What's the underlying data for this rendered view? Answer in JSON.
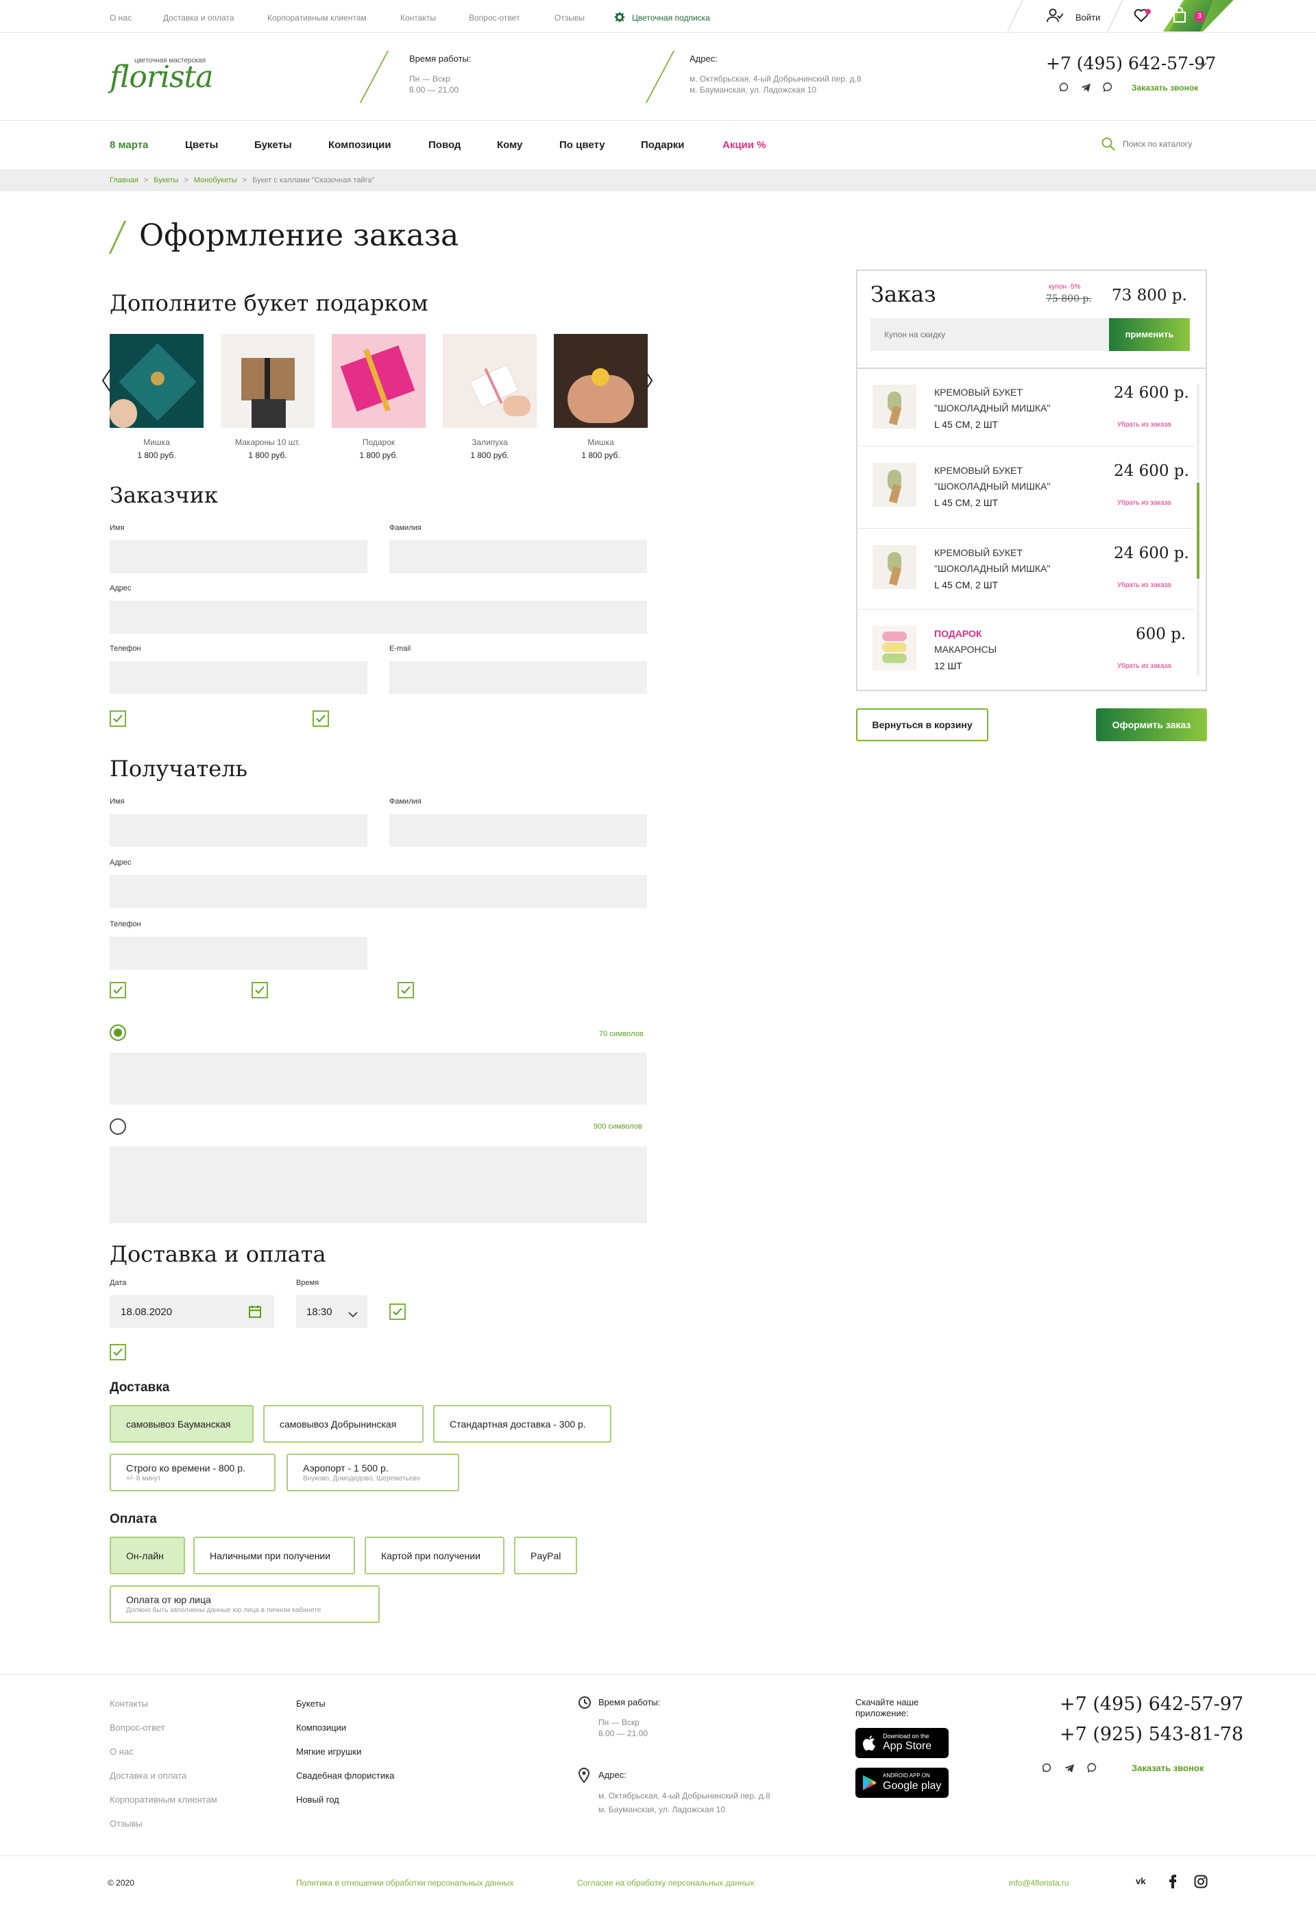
{
  "topbar": {
    "links": [
      "О нас",
      "Доставка и оплата",
      "Корпоративным клиентам",
      "Контакты",
      "Вопрос-ответ",
      "Отзывы"
    ],
    "subscription": "Цветочная подписка",
    "login": "Войти",
    "cart_count": "3"
  },
  "header": {
    "logo_tagline": "цветочная мастерская",
    "logo_text": "florista",
    "hours_label": "Время работы:",
    "hours_days": "Пн — Вскр",
    "hours_time": "8.00 — 21.00",
    "address_label": "Адрес:",
    "address_1": "м. Октябрьская, 4-ый Добрынинский пер. д.8",
    "address_2": "м. Бауманская, ул. Ладожская 10",
    "phone": "+7 (495) 642-57-97",
    "callback": "Заказать звонок"
  },
  "nav": {
    "items": [
      "8 марта",
      "Цветы",
      "Букеты",
      "Композиции",
      "Повод",
      "Кому",
      "По цвету",
      "Подарки",
      "Акции %"
    ],
    "search_placeholder": "Поиск по каталогу"
  },
  "breadcrumb": [
    "Главная",
    ">",
    "Букеты",
    ">",
    "Монобукеты",
    ">",
    "Букет с каллами \"Сказочная тайга\""
  ],
  "page_title": "Оформление заказа",
  "gifts": {
    "title": "Дополните букет подарком",
    "items": [
      {
        "name": "Мишка",
        "price": "1 800 руб."
      },
      {
        "name": "Макароны 10 шт.",
        "price": "1 800 руб."
      },
      {
        "name": "Подарок",
        "price": "1 800 руб."
      },
      {
        "name": "Залипуха",
        "price": "1 800 руб."
      },
      {
        "name": "Мишка",
        "price": "1 800 руб."
      }
    ]
  },
  "customer": {
    "title": "Заказчик",
    "first_name": "Имя",
    "last_name": "Фамилия",
    "address": "Адрес",
    "phone": "Телефон",
    "email": "E-mail"
  },
  "recipient": {
    "title": "Получатель",
    "first_name": "Имя",
    "last_name": "Фамилия",
    "address": "Адрес",
    "phone": "Телефон",
    "counter_1": "70 символов",
    "counter_2": "900 символов"
  },
  "delivery": {
    "title": "Доставка и оплата",
    "date_label": "Дата",
    "date_value": "18.08.2020",
    "time_label": "Время",
    "time_value": "18:30",
    "delivery_title": "Доставка",
    "options": [
      {
        "label": "самовывоз Бауманская",
        "sub": ""
      },
      {
        "label": "самовывоз Добрынинская",
        "sub": ""
      },
      {
        "label": "Стандартная доставка - 300 р.",
        "sub": ""
      },
      {
        "label": "Строго ко времени - 800 р.",
        "sub": "+/- 8 минут"
      },
      {
        "label": "Аэропорт - 1 500 р.",
        "sub": "Внуково, Домодедово, Шереметьево"
      }
    ],
    "payment_title": "Оплата",
    "payments": [
      {
        "label": "Он-лайн",
        "sub": ""
      },
      {
        "label": "Наличными при получении",
        "sub": ""
      },
      {
        "label": "Картой при получении",
        "sub": ""
      },
      {
        "label": "PayPal",
        "sub": ""
      },
      {
        "label": "Оплата от юр лица",
        "sub": "Должно быть заполнены данные юр лица в личном кабинете"
      }
    ]
  },
  "order": {
    "title": "Заказ",
    "coupon_note": "купон -5%",
    "old_total": "75 800 р.",
    "total": "73 800 р.",
    "coupon_placeholder": "Купон на скидку",
    "apply": "применить",
    "items": [
      {
        "title_1": "КРЕМОВЫЙ БУКЕТ",
        "title_2": "\"ШОКОЛАДНЫЙ МИШКА\"",
        "meta": "L 45 СМ, 2 ШТ",
        "price": "24 600 р.",
        "remove": "Убрать из заказа"
      },
      {
        "title_1": "КРЕМОВЫЙ БУКЕТ",
        "title_2": "\"ШОКОЛАДНЫЙ МИШКА\"",
        "meta": "L 45 СМ, 2 ШТ",
        "price": "24 600 р.",
        "remove": "Убрать из заказа"
      },
      {
        "title_1": "КРЕМОВЫЙ БУКЕТ",
        "title_2": "\"ШОКОЛАДНЫЙ МИШКА\"",
        "meta": "L 45 СМ, 2 ШТ",
        "price": "24 600 р.",
        "remove": "Убрать из заказа"
      },
      {
        "title_1": "ПОДАРОК",
        "title_2": "МАКАРОНСЫ",
        "meta": "12 ШТ",
        "price": "600 р.",
        "remove": "Убрать из заказа"
      }
    ],
    "back": "Вернуться в корзину",
    "submit": "Оформить заказ"
  },
  "footer": {
    "col1": [
      "Контакты",
      "Вопрос-ответ",
      "О нас",
      "Доставка и оплата",
      "Корпоративным клиентам",
      "Отзывы"
    ],
    "col2": [
      "Букеты",
      "Композиции",
      "Мягкие игрушки",
      "Свадебная флористика",
      "Новый год"
    ],
    "hours_label": "Время работы:",
    "hours_days": "Пн — Вскр",
    "hours_time": "8.00 — 21.00",
    "address_label": "Адрес:",
    "address_1": "м. Октябрьская, 4-ый Добрынинский пер. д.8",
    "address_2": "м. Бауманская, ул. Ладожская 10",
    "app_title_1": "Скачайте наше",
    "app_title_2": "приложение:",
    "appstore_small": "Download on the",
    "appstore": "App Store",
    "gplay_small": "ANDROID APP ON",
    "gplay": "Google play",
    "phone_1": "+7 (495) 642-57-97",
    "phone_2": "+7 (925) 543-81-78",
    "callback": "Заказать звонок",
    "copyright": "© 2020",
    "policy": "Политика в отношении обработки персональных данных",
    "consent": "Согласие на обработку персональных данных",
    "email": "info@4florista.ru"
  },
  "colors": {
    "accent": "#5e9e1e",
    "pink": "#e0307f",
    "light_green": "#d8eec3",
    "input_bg": "#f0f0f0"
  }
}
